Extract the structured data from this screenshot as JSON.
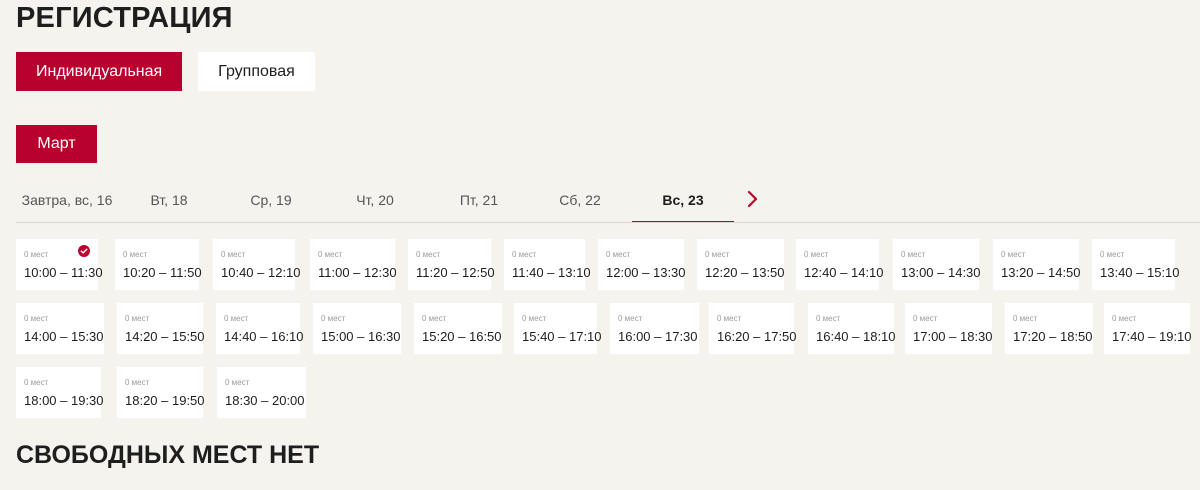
{
  "page": {
    "title": "РЕГИСТРАЦИЯ",
    "no_places": "СВОБОДНЫХ МЕСТ НЕТ"
  },
  "colors": {
    "accent": "#b8002e",
    "background": "#f4f3ee"
  },
  "registration_types": [
    {
      "label": "Индивидуальная",
      "active": true
    },
    {
      "label": "Групповая",
      "active": false
    }
  ],
  "month": "Март",
  "days": [
    {
      "label": "Завтра, вс, 16",
      "active": false
    },
    {
      "label": "Вт, 18",
      "active": false
    },
    {
      "label": "Ср, 19",
      "active": false
    },
    {
      "label": "Чт, 20",
      "active": false
    },
    {
      "label": "Пт, 21",
      "active": false
    },
    {
      "label": "Сб, 22",
      "active": false
    },
    {
      "label": "Вс, 23",
      "active": true
    }
  ],
  "next_icon": "chevron-right-icon",
  "slots": [
    {
      "places": "0 мест",
      "time": "10:00 – 11:30",
      "selected": true
    },
    {
      "places": "0 мест",
      "time": "10:20 – 11:50",
      "selected": false
    },
    {
      "places": "0 мест",
      "time": "10:40 – 12:10",
      "selected": false
    },
    {
      "places": "0 мест",
      "time": "11:00 – 12:30",
      "selected": false
    },
    {
      "places": "0 мест",
      "time": "11:20 – 12:50",
      "selected": false
    },
    {
      "places": "0 мест",
      "time": "11:40 – 13:10",
      "selected": false
    },
    {
      "places": "0 мест",
      "time": "12:00 – 13:30",
      "selected": false
    },
    {
      "places": "0 мест",
      "time": "12:20 – 13:50",
      "selected": false
    },
    {
      "places": "0 мест",
      "time": "12:40 – 14:10",
      "selected": false
    },
    {
      "places": "0 мест",
      "time": "13:00 – 14:30",
      "selected": false
    },
    {
      "places": "0 мест",
      "time": "13:20 – 14:50",
      "selected": false
    },
    {
      "places": "0 мест",
      "time": "13:40 – 15:10",
      "selected": false
    },
    {
      "places": "0 мест",
      "time": "14:00 – 15:30",
      "selected": false
    },
    {
      "places": "0 мест",
      "time": "14:20 – 15:50",
      "selected": false
    },
    {
      "places": "0 мест",
      "time": "14:40 – 16:10",
      "selected": false
    },
    {
      "places": "0 мест",
      "time": "15:00 – 16:30",
      "selected": false
    },
    {
      "places": "0 мест",
      "time": "15:20 – 16:50",
      "selected": false
    },
    {
      "places": "0 мест",
      "time": "15:40 – 17:10",
      "selected": false
    },
    {
      "places": "0 мест",
      "time": "16:00 – 17:30",
      "selected": false
    },
    {
      "places": "0 мест",
      "time": "16:20 – 17:50",
      "selected": false
    },
    {
      "places": "0 мест",
      "time": "16:40 – 18:10",
      "selected": false
    },
    {
      "places": "0 мест",
      "time": "17:00 – 18:30",
      "selected": false
    },
    {
      "places": "0 мест",
      "time": "17:20 – 18:50",
      "selected": false
    },
    {
      "places": "0 мест",
      "time": "17:40 – 19:10",
      "selected": false
    },
    {
      "places": "0 мест",
      "time": "18:00 – 19:30",
      "selected": false
    },
    {
      "places": "0 мест",
      "time": "18:20 – 19:50",
      "selected": false
    },
    {
      "places": "0 мест",
      "time": "18:30 – 20:00",
      "selected": false
    }
  ]
}
